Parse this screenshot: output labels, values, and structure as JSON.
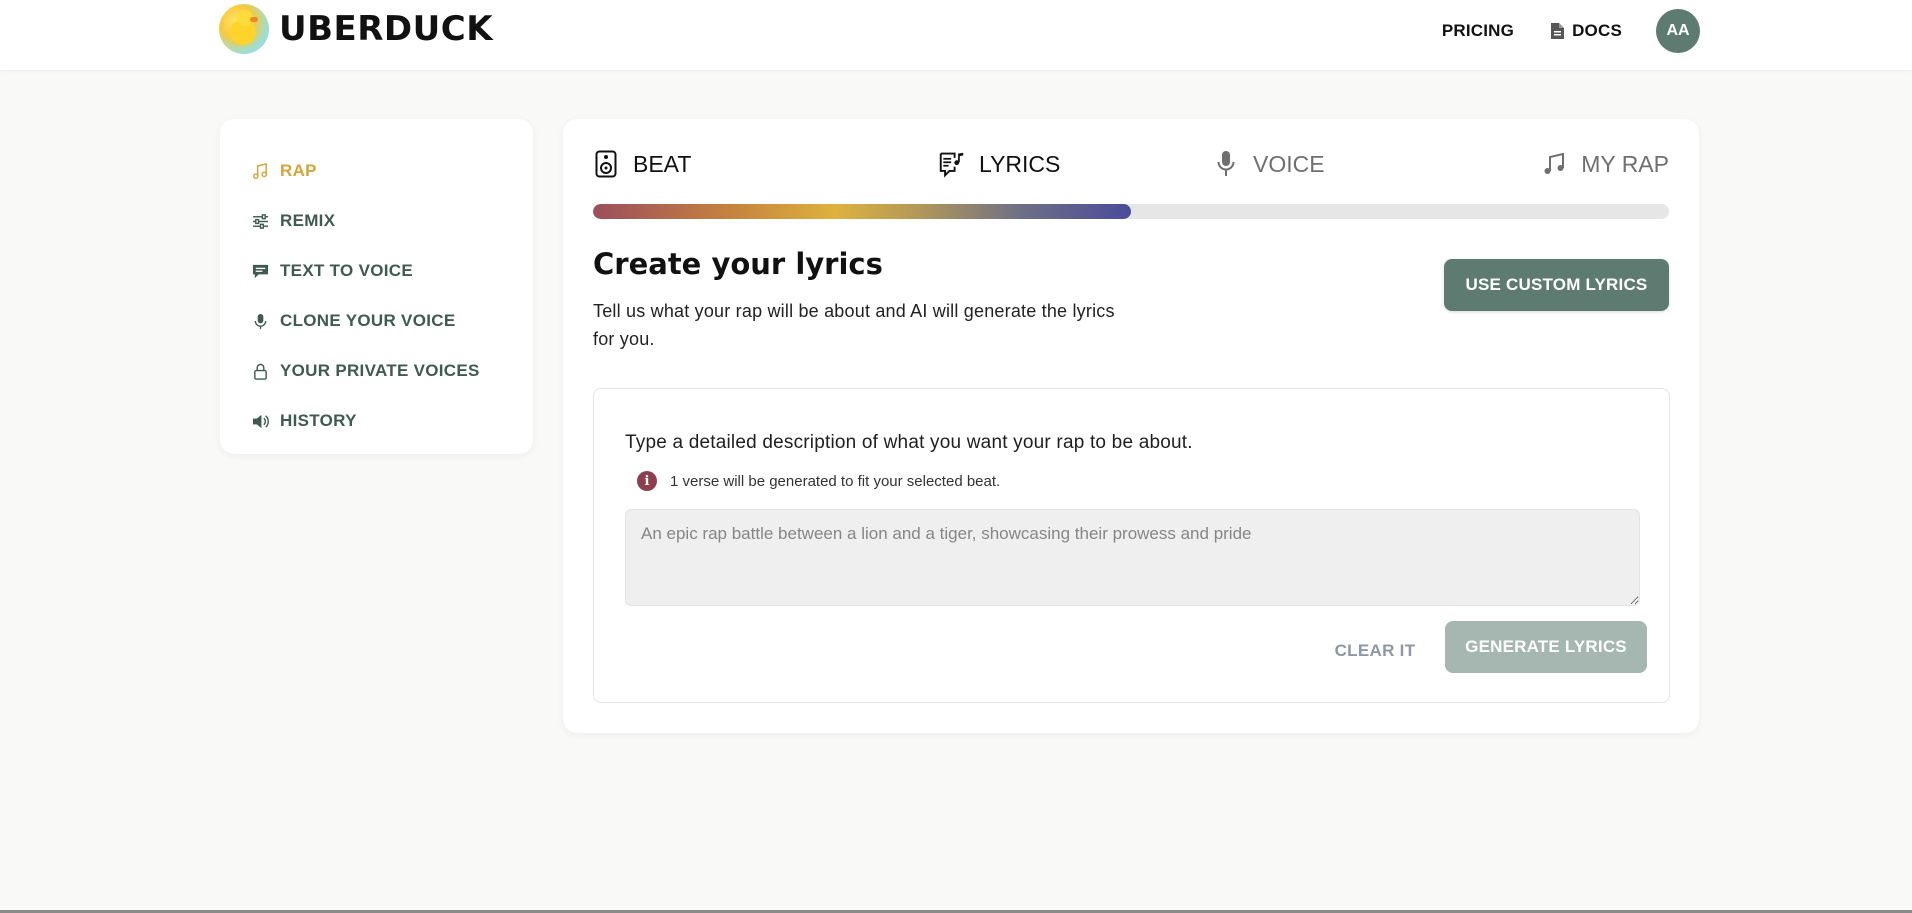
{
  "header": {
    "brand": "UBERDUCK",
    "nav": {
      "pricing": "PRICING",
      "docs": "DOCS"
    },
    "avatar_initials": "AA"
  },
  "sidebar": {
    "items": [
      {
        "label": "RAP",
        "icon": "music-note-icon",
        "active": true
      },
      {
        "label": "REMIX",
        "icon": "sliders-icon"
      },
      {
        "label": "TEXT TO VOICE",
        "icon": "chat-bubble-icon"
      },
      {
        "label": "CLONE YOUR VOICE",
        "icon": "microphone-icon"
      },
      {
        "label": "YOUR PRIVATE VOICES",
        "icon": "lock-icon"
      },
      {
        "label": "HISTORY",
        "icon": "speaker-icon"
      }
    ]
  },
  "steps": [
    {
      "label": "BEAT",
      "icon": "speaker-box-icon",
      "state": "done"
    },
    {
      "label": "LYRICS",
      "icon": "lyrics-icon",
      "state": "current"
    },
    {
      "label": "VOICE",
      "icon": "microphone-icon",
      "state": "upcoming"
    },
    {
      "label": "MY RAP",
      "icon": "music-note-icon",
      "state": "upcoming"
    }
  ],
  "progress_fraction": 0.5,
  "lyrics": {
    "title": "Create your lyrics",
    "description": "Tell us what your rap will be about and AI will generate the lyrics for you.",
    "custom_button": "USE CUSTOM LYRICS",
    "form_label": "Type a detailed description of what you want your rap to be about.",
    "info_text": "1 verse will be generated to fit your selected beat.",
    "placeholder": "An epic rap battle between a lion and a tiger, showcasing their prowess and pride",
    "value": "",
    "clear_button": "CLEAR IT",
    "generate_button": "GENERATE LYRICS"
  },
  "colors": {
    "accent_gold": "#d1a63b",
    "brand_green": "#5d7b70",
    "disabled_green": "#a5b7b0",
    "sidebar_text": "#3f5a52",
    "info_red": "#8d3f4e"
  }
}
